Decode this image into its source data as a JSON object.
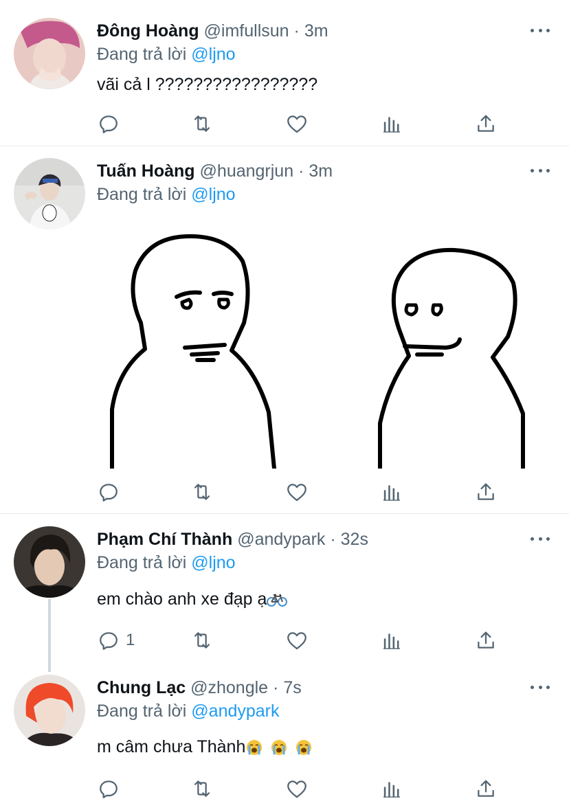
{
  "tweets": [
    {
      "name": "Đông Hoàng",
      "handle": "@imfullsun",
      "sep": "·",
      "time": "3m",
      "reply_prefix": "Đang trả lời ",
      "reply_to": "@ljno",
      "text": "vãi cả l ?????????????????",
      "reply_count": ""
    },
    {
      "name": "Tuấn Hoàng",
      "handle": "@huangrjun",
      "sep": "·",
      "time": "3m",
      "reply_prefix": "Đang trả lời ",
      "reply_to": "@ljno",
      "text": "",
      "reply_count": ""
    },
    {
      "name": "Phạm Chí Thành",
      "handle": "@andypark",
      "sep": "·",
      "time": "32s",
      "reply_prefix": "Đang trả lời ",
      "reply_to": "@ljno",
      "text": "em chào anh xe đạp ạ",
      "text_emoji": "bicycle",
      "reply_count": "1"
    },
    {
      "name": "Chung Lạc",
      "handle": "@zhongle",
      "sep": "·",
      "time": "7s",
      "reply_prefix": "Đang trả lời ",
      "reply_to": "@andypark",
      "text": "m câm chưa Thành",
      "text_emoji": "loudly-crying-face x3",
      "reply_count": ""
    }
  ],
  "icons": {
    "actions": [
      "reply-icon",
      "retweet-icon",
      "like-icon",
      "analytics-icon",
      "share-icon"
    ],
    "more": "more-icon"
  },
  "colors": {
    "text": "#0f1419",
    "secondary": "#536471",
    "link": "#1d9bf0",
    "divider": "#e7e9ea",
    "thread_line": "#cfd9de"
  }
}
